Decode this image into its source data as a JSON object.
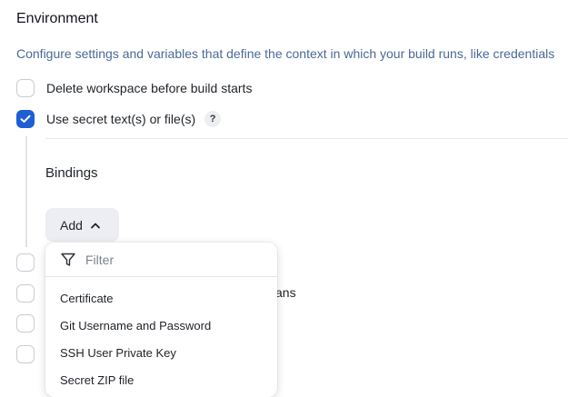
{
  "section": {
    "title": "Environment",
    "description": "Configure settings and variables that define the context in which your build runs, like credentials"
  },
  "options": [
    {
      "label": "Delete workspace before build starts",
      "checked": false
    },
    {
      "label": "Use secret text(s) or file(s)",
      "checked": true,
      "help": "?"
    }
  ],
  "bindings": {
    "title": "Bindings",
    "add_label": "Add"
  },
  "background": {
    "partial_text": "ans"
  },
  "dropdown": {
    "filter_placeholder": "Filter",
    "items": [
      {
        "label": "Certificate"
      },
      {
        "label": "Git Username and Password"
      },
      {
        "label": "SSH User Private Key"
      },
      {
        "label": "Secret ZIP file"
      }
    ]
  },
  "colors": {
    "accent": "#1e5fd3",
    "description_text": "#4a6a95"
  }
}
